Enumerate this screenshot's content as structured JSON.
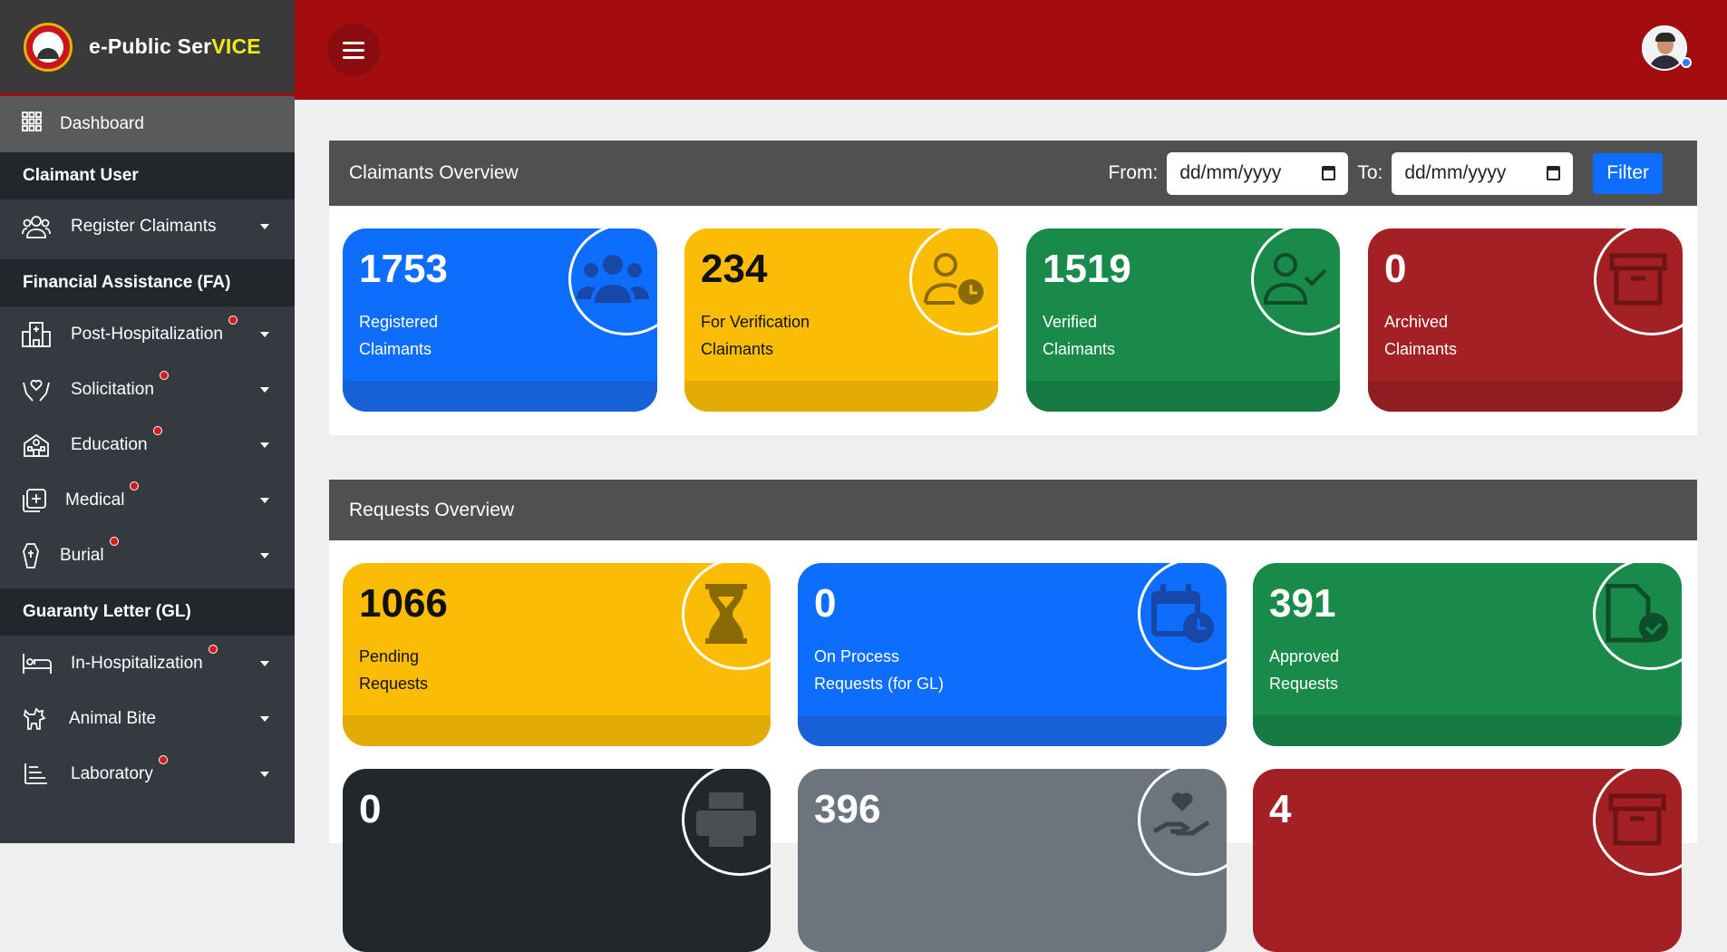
{
  "app": {
    "brand_main": "e-Public Ser",
    "brand_hl": "VICE"
  },
  "colors": {
    "topbar": "#a30d10",
    "blue": "#0d6efd",
    "yellow": "#fbbc05",
    "green": "#1a8a4a",
    "red": "#a32024",
    "dark": "#22272b",
    "gray": "#6c757d"
  },
  "sidebar": {
    "dashboard": "Dashboard",
    "sections": {
      "claimant": "Claimant User",
      "fa": "Financial Assistance (FA)",
      "gl": "Guaranty Letter (GL)"
    },
    "items": {
      "register": "Register Claimants",
      "post_hosp": "Post-Hospitalization",
      "solicitation": "Solicitation",
      "education": "Education",
      "medical": "Medical",
      "burial": "Burial",
      "in_hosp": "In-Hospitalization",
      "animal_bite": "Animal Bite",
      "laboratory": "Laboratory"
    }
  },
  "claimants_overview": {
    "title": "Claimants Overview",
    "from_label": "From:",
    "to_label": "To:",
    "from_placeholder": "dd/mm/yyyy",
    "to_placeholder": "dd/mm/yyyy",
    "filter_label": "Filter",
    "cards": [
      {
        "value": "1753",
        "line1": "Registered",
        "line2": "Claimants",
        "icon": "users-icon"
      },
      {
        "value": "234",
        "line1": "For Verification",
        "line2": "Claimants",
        "icon": "user-clock-icon"
      },
      {
        "value": "1519",
        "line1": "Verified",
        "line2": "Claimants",
        "icon": "user-check-icon"
      },
      {
        "value": "0",
        "line1": "Archived",
        "line2": "Claimants",
        "icon": "archive-icon"
      }
    ]
  },
  "requests_overview": {
    "title": "Requests Overview",
    "cards": [
      {
        "value": "1066",
        "line1": "Pending",
        "line2": "Requests",
        "icon": "hourglass-icon"
      },
      {
        "value": "0",
        "line1": "On Process",
        "line2": "Requests (for GL)",
        "icon": "calendar-clock-icon"
      },
      {
        "value": "391",
        "line1": "Approved",
        "line2": "Requests",
        "icon": "file-check-icon"
      },
      {
        "value": "0",
        "icon": "printer-icon"
      },
      {
        "value": "396",
        "icon": "hand-heart-icon"
      },
      {
        "value": "4",
        "icon": "archive-icon"
      }
    ]
  }
}
